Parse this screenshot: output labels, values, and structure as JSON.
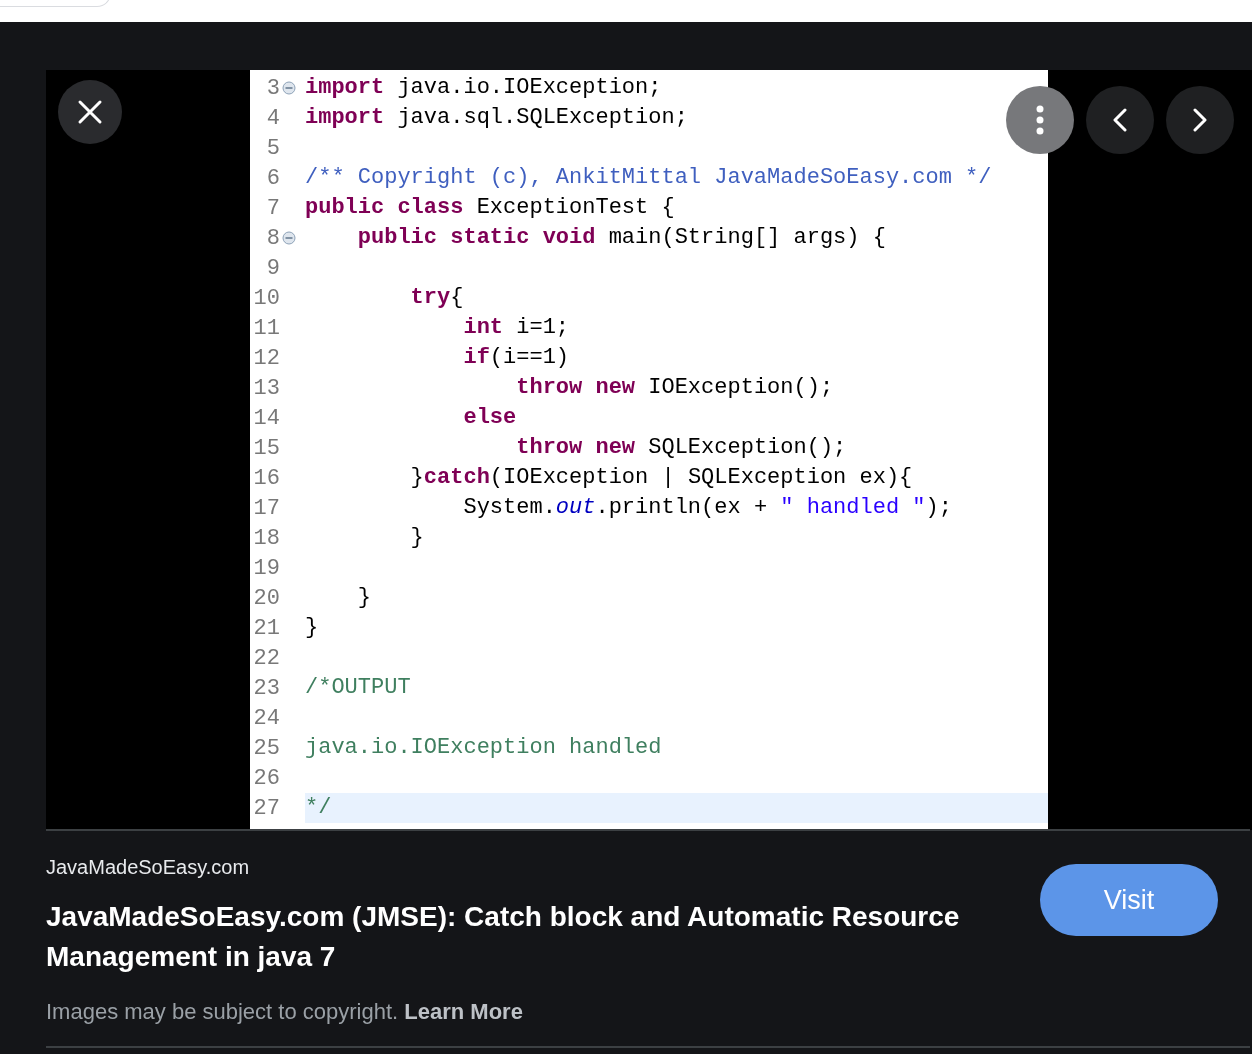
{
  "code": {
    "lines": [
      {
        "number": "3",
        "fold": true,
        "current": false,
        "tokens": [
          {
            "kind": "kw",
            "text": "import"
          },
          {
            "kind": "plain",
            "text": " java.io.IOException;"
          }
        ]
      },
      {
        "number": "4",
        "fold": false,
        "current": false,
        "tokens": [
          {
            "kind": "kw",
            "text": "import"
          },
          {
            "kind": "plain",
            "text": " java.sql.SQLException;"
          }
        ]
      },
      {
        "number": "5",
        "fold": false,
        "current": false
      },
      {
        "number": "6",
        "fold": false,
        "current": false,
        "tokens": [
          {
            "kind": "javadoc",
            "text": "/** Copyright (c), AnkitMittal JavaMadeSoEasy.com */"
          }
        ]
      },
      {
        "number": "7",
        "fold": false,
        "current": false,
        "tokens": [
          {
            "kind": "kw",
            "text": "public class"
          },
          {
            "kind": "plain",
            "text": " ExceptionTest {"
          }
        ]
      },
      {
        "number": "8",
        "fold": true,
        "current": false,
        "tokens": [
          {
            "kind": "kw",
            "text": "    public static void"
          },
          {
            "kind": "plain",
            "text": " main(String[] args) {"
          }
        ]
      },
      {
        "number": "9",
        "fold": false,
        "current": false
      },
      {
        "number": "10",
        "fold": false,
        "current": false,
        "tokens": [
          {
            "kind": "kw",
            "text": "        try"
          },
          {
            "kind": "plain",
            "text": "{"
          }
        ]
      },
      {
        "number": "11",
        "fold": false,
        "current": false,
        "tokens": [
          {
            "kind": "kw",
            "text": "            int"
          },
          {
            "kind": "plain",
            "text": " i=1;"
          }
        ]
      },
      {
        "number": "12",
        "fold": false,
        "current": false,
        "tokens": [
          {
            "kind": "kw",
            "text": "            if"
          },
          {
            "kind": "plain",
            "text": "(i==1)"
          }
        ]
      },
      {
        "number": "13",
        "fold": false,
        "current": false,
        "tokens": [
          {
            "kind": "kw",
            "text": "                throw new"
          },
          {
            "kind": "plain",
            "text": " IOException();"
          }
        ]
      },
      {
        "number": "14",
        "fold": false,
        "current": false,
        "tokens": [
          {
            "kind": "kw",
            "text": "            else"
          }
        ]
      },
      {
        "number": "15",
        "fold": false,
        "current": false,
        "tokens": [
          {
            "kind": "kw",
            "text": "                throw new"
          },
          {
            "kind": "plain",
            "text": " SQLException();"
          }
        ]
      },
      {
        "number": "16",
        "fold": false,
        "current": false,
        "tokens": [
          {
            "kind": "plain",
            "text": "        }"
          },
          {
            "kind": "kw",
            "text": "catch"
          },
          {
            "kind": "plain",
            "text": "(IOException | SQLException ex){"
          }
        ]
      },
      {
        "number": "17",
        "fold": false,
        "current": false,
        "tokens": [
          {
            "kind": "plain",
            "text": "            System."
          },
          {
            "kind": "field",
            "text": "out"
          },
          {
            "kind": "plain",
            "text": ".println(ex + "
          },
          {
            "kind": "string",
            "text": "\" handled \""
          },
          {
            "kind": "plain",
            "text": ");"
          }
        ]
      },
      {
        "number": "18",
        "fold": false,
        "current": false,
        "tokens": [
          {
            "kind": "plain",
            "text": "        }"
          }
        ]
      },
      {
        "number": "19",
        "fold": false,
        "current": false
      },
      {
        "number": "20",
        "fold": false,
        "current": false,
        "tokens": [
          {
            "kind": "plain",
            "text": "    }"
          }
        ]
      },
      {
        "number": "21",
        "fold": false,
        "current": false,
        "tokens": [
          {
            "kind": "plain",
            "text": "}"
          }
        ]
      },
      {
        "number": "22",
        "fold": false,
        "current": false
      },
      {
        "number": "23",
        "fold": false,
        "current": false,
        "tokens": [
          {
            "kind": "comment",
            "text": "/*OUTPUT"
          }
        ]
      },
      {
        "number": "24",
        "fold": false,
        "current": false
      },
      {
        "number": "25",
        "fold": false,
        "current": false,
        "tokens": [
          {
            "kind": "comment",
            "text": "java.io.IOException handled"
          }
        ]
      },
      {
        "number": "26",
        "fold": false,
        "current": false
      },
      {
        "number": "27",
        "fold": false,
        "current": true,
        "tokens": [
          {
            "kind": "comment",
            "text": "*/"
          }
        ]
      }
    ]
  },
  "result": {
    "source": "JavaMadeSoEasy.com",
    "title": "JavaMadeSoEasy.com (JMSE): Catch block and Automatic Resource Management in java 7",
    "visit_button": "Visit",
    "notice": "Images may be subject to copyright.",
    "notice_link": "Learn More"
  }
}
